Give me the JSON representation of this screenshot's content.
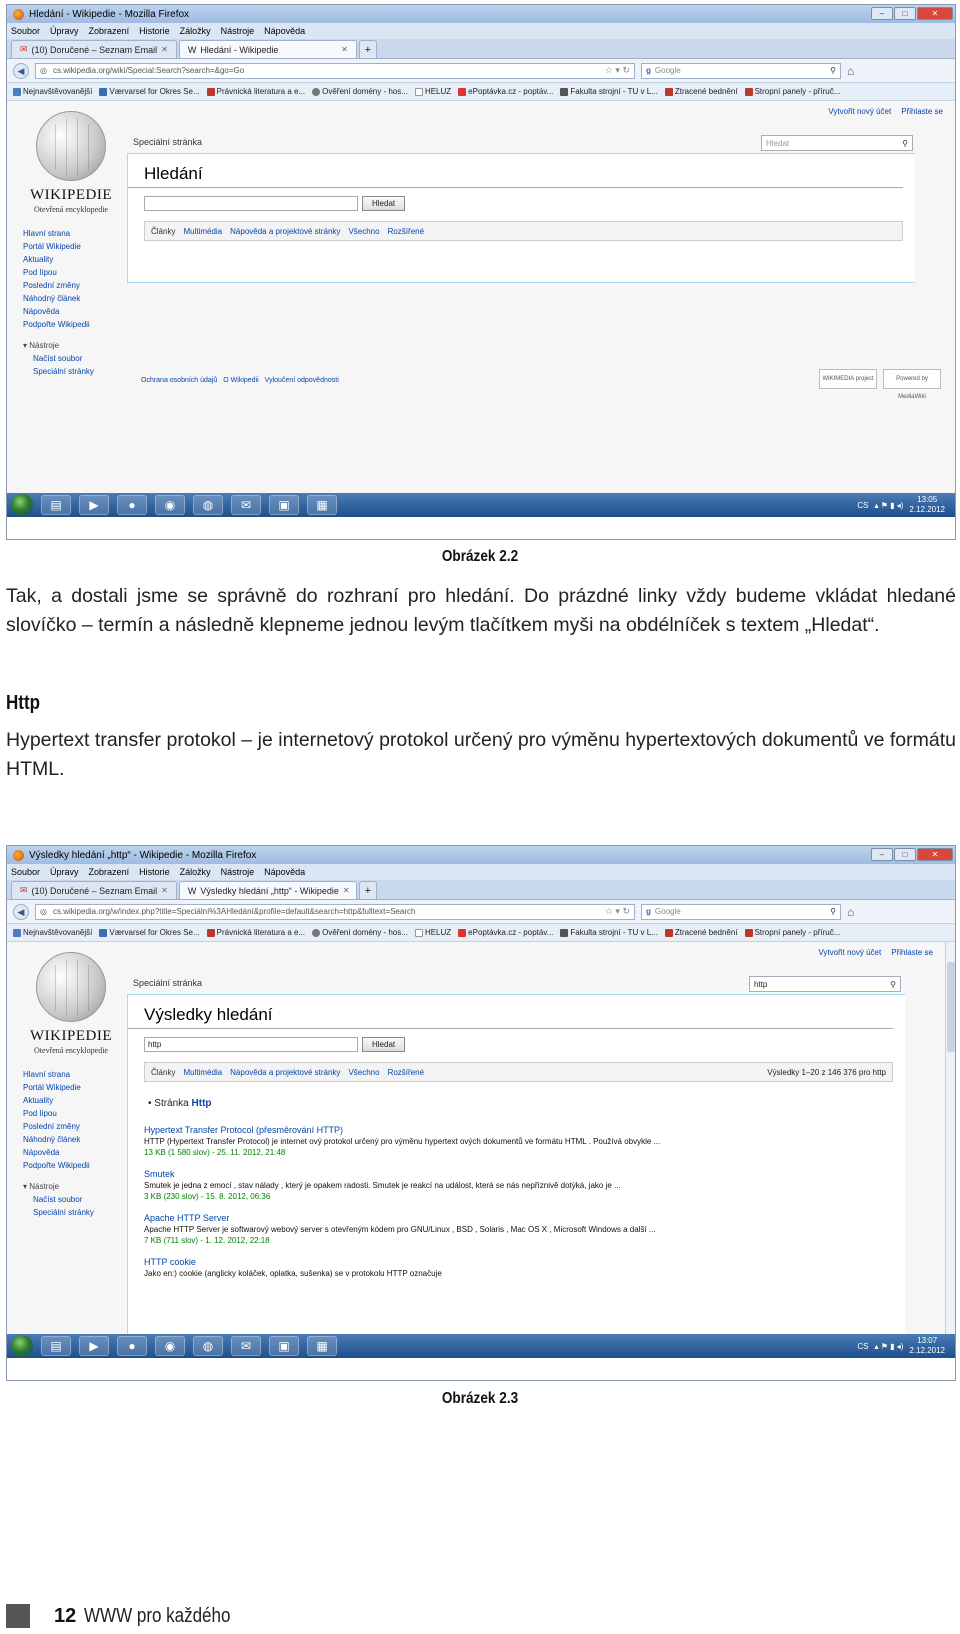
{
  "screenshot1": {
    "window_title": "Hledání - Wikipedie - Mozilla Firefox",
    "menu": [
      "Soubor",
      "Úpravy",
      "Zobrazení",
      "Historie",
      "Záložky",
      "Nástroje",
      "Nápověda"
    ],
    "tab1": "(10) Doručené – Seznam Email",
    "tab2": "Hledání - Wikipedie",
    "tab_plus": "+",
    "url": "cs.wikipedia.org/wiki/Special:Search?search=&go=Go",
    "search_engine": "Google",
    "bookmarks": [
      "Nejnavštěvovanější",
      "Værvarsel for Okres Se...",
      "Právnická literatura a e...",
      "Ověření domény - hos...",
      "HELUZ",
      "ePoptávka.cz - poptáv...",
      "Fakulta strojní - TU v L...",
      "Ztracené bednění",
      "Stropní panely - příruč..."
    ],
    "personal_create": "Vytvořit nový účet",
    "personal_login": "Přihlaste se",
    "wiki_name": "WIKIPEDIE",
    "wiki_tagline": "Otevřená encyklopedie",
    "sidebar": [
      "Hlavní strana",
      "Portál Wikipedie",
      "Aktuality",
      "Pod lípou",
      "Poslední změny",
      "Náhodný článek",
      "Nápověda",
      "Podpořte Wikipedii"
    ],
    "tools_label": "Nástroje",
    "tools": [
      "Načíst soubor",
      "Speciální stránky"
    ],
    "special_tab": "Speciální stránka",
    "top_search_placeholder": "Hledat",
    "page_title": "Hledání",
    "query_value": "",
    "search_button": "Hledat",
    "profiles": [
      "Články",
      "Multimédia",
      "Nápověda a projektové stránky",
      "Všechno",
      "Rozšířené"
    ],
    "footer_links": [
      "Ochrana osobních údajů",
      "O Wikipedii",
      "Vyloučení odpovědnosti"
    ],
    "badge1": "WIKIMEDIA project",
    "badge2": "Powered by MediaWiki",
    "tray_lang": "CS",
    "clock_time": "13:05",
    "clock_date": "2.12.2012"
  },
  "caption1": "Obrázek 2.2",
  "paragraph1": "Tak, a dostali jsme se správně do rozhraní pro hledání. Do prázdné linky vždy budeme vkládat hledané slovíčko – termín a následně klepneme jednou levým tlačítkem myši na obdélníček s textem „Hledat“.",
  "heading_http": "Http",
  "paragraph2": "Hypertext transfer protokol – je internetový protokol určený pro výměnu hypertextových dokumentů ve formátu HTML.",
  "screenshot2": {
    "window_title": "Výsledky hledání „http“ - Wikipedie - Mozilla Firefox",
    "tab1": "(10) Doručené – Seznam Email",
    "tab2": "Výsledky hledání „http“ - Wikipedie",
    "url": "cs.wikipedia.org/w/index.php?title=Speciální%3AHledání&profile=default&search=http&fulltext=Search",
    "top_search_value": "http",
    "page_title": "Výsledky hledání",
    "query_value": "http",
    "search_button": "Hledat",
    "result_count": "Výsledky 1–20 z 146 376 pro http",
    "bullet_prefix": "Stránka",
    "bullet_term": "Http",
    "results": [
      {
        "title": "Hypertext Transfer Protocol (přesměrování HTTP)",
        "snippet": "HTTP (Hypertext Transfer Protocol) je internet ový protokol určený pro výměnu hypertext ových dokumentů ve formátu HTML . Používá obvykle ...",
        "meta": "13 KB (1 580 slov) - 25. 11. 2012, 21:48"
      },
      {
        "title": "Smutek",
        "snippet": "Smutek je jedna z emocí , stav nálady , který je opakem radosti. Smutek je reakcí na událost, která se nás nepříznivě dotýká, jako je ...",
        "meta": "3 KB (230 slov) - 15. 8. 2012, 06:36"
      },
      {
        "title": "Apache HTTP Server",
        "snippet": "Apache HTTP Server je softwarový webový server s otevřeným kódem pro GNU/Linux , BSD , Solaris , Mac OS X , Microsoft Windows a další ...",
        "meta": "7 KB (711 slov) - 1. 12. 2012, 22:18"
      },
      {
        "title": "HTTP cookie",
        "snippet": "Jako en:) cookie (anglicky koláček, oplatka, sušenka) se v protokolu HTTP označuje",
        "meta": ""
      }
    ],
    "clock_time": "13:07",
    "clock_date": "2.12.2012"
  },
  "caption2": "Obrázek 2.3",
  "footer": {
    "page": "12",
    "book": "WWW pro každého"
  }
}
